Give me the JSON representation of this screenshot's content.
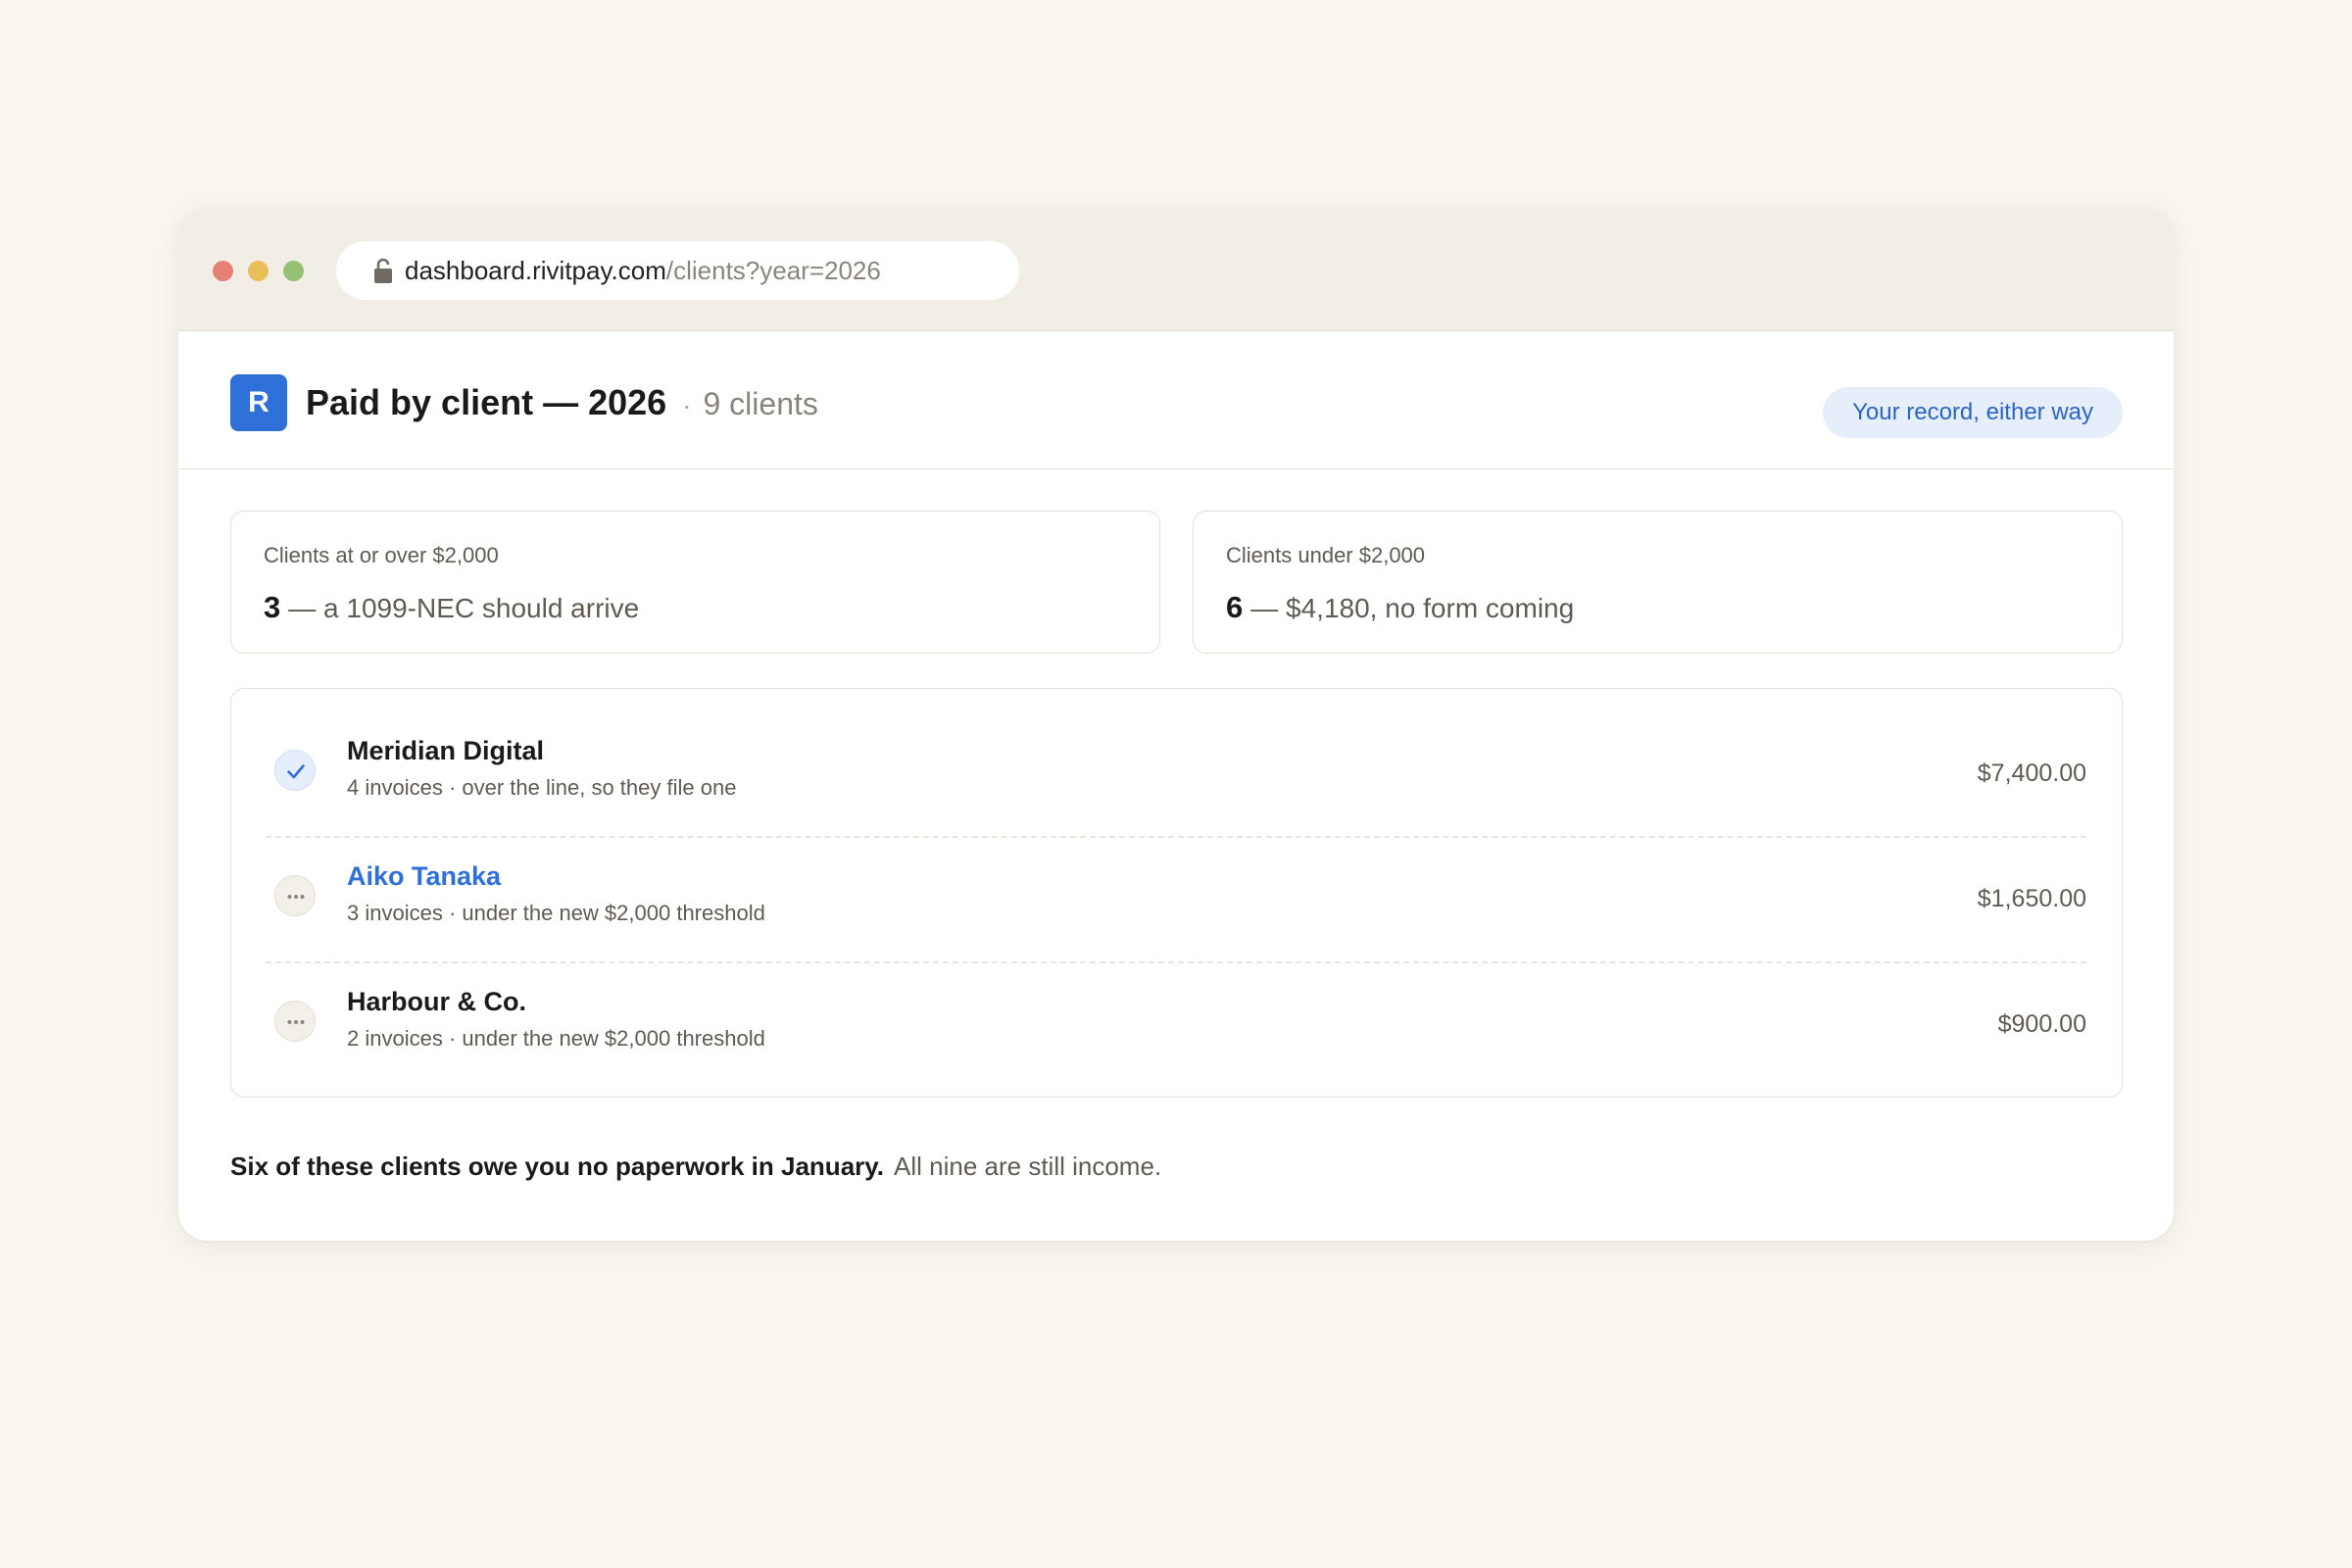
{
  "browser": {
    "url_host": "dashboard.rivitpay.com",
    "url_path": "/clients?year=2026",
    "traffic_lights": {
      "close": "#e58074",
      "minimize": "#e8bf59",
      "zoom": "#96c175"
    }
  },
  "header": {
    "logo_letter": "R",
    "title": "Paid by client — 2026",
    "separator": "·",
    "client_count": "9 clients",
    "badge": "Your record, either way",
    "accent_color": "#2f6fd8"
  },
  "stats": [
    {
      "label": "Clients at or over $2,000",
      "number": "3",
      "description": "— a 1099-NEC should arrive"
    },
    {
      "label": "Clients under $2,000",
      "number": "6",
      "description": "— $4,180, no form coming"
    }
  ],
  "clients": [
    {
      "name": "Meridian Digital",
      "subtitle": "4 invoices · over the line, so they file one",
      "amount": "$7,400.00",
      "status": "check-icon",
      "highlighted": false
    },
    {
      "name": "Aiko Tanaka",
      "subtitle": "3 invoices · under the new $2,000 threshold",
      "amount": "$1,650.00",
      "status": "ellipsis-icon",
      "highlighted": true
    },
    {
      "name": "Harbour & Co.",
      "subtitle": "2 invoices · under the new $2,000 threshold",
      "amount": "$900.00",
      "status": "ellipsis-icon",
      "highlighted": false
    }
  ],
  "footer": {
    "strong": "Six of these clients owe you no paperwork in January.",
    "rest": "All nine are still income."
  }
}
